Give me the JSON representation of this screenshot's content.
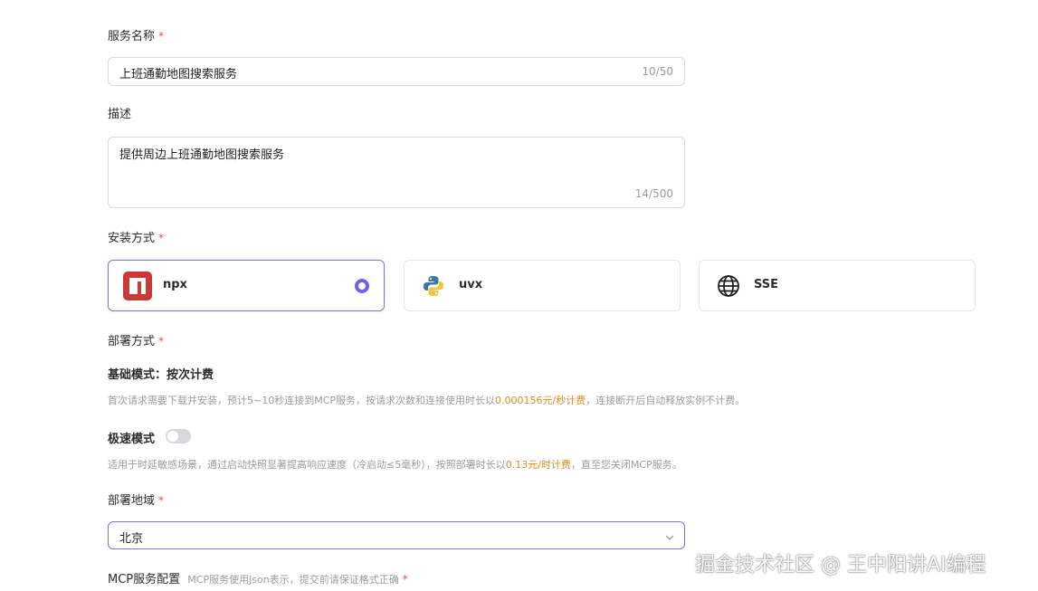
{
  "form": {
    "service_name": {
      "label": "服务名称",
      "required": "*",
      "value": "上班通勤地图搜索服务",
      "counter": "10/50"
    },
    "description": {
      "label": "描述",
      "value": "提供周边上班通勤地图搜索服务",
      "counter": "14/500"
    },
    "install_method": {
      "label": "安装方式",
      "required": "*",
      "options": [
        {
          "name": "npx",
          "icon": "npm-icon",
          "selected": true
        },
        {
          "name": "uvx",
          "icon": "python-icon",
          "selected": false
        },
        {
          "name": "SSE",
          "icon": "globe-icon",
          "selected": false
        }
      ]
    },
    "deploy_method": {
      "label": "部署方式",
      "required": "*",
      "basic": {
        "title": "基础模式：按次计费",
        "desc_pre": "首次请求需要下载并安装，预计5~10秒连接到MCP服务，按请求次数和连接使用时长以",
        "price": "0.000156元/秒计费",
        "desc_post": "，连接断开后自动释放实例不计费。"
      },
      "fast": {
        "title": "极速模式",
        "enabled": false,
        "desc_pre": "适用于时延敏感场景，通过启动快照显著提高响应速度（冷启动≤5毫秒），按照部署时长以",
        "price": "0.13元/时计费",
        "desc_post": "，直至您关闭MCP服务。"
      }
    },
    "region": {
      "label": "部署地域",
      "required": "*",
      "value": "北京"
    },
    "mcp_config": {
      "label": "MCP服务配置",
      "hint": "MCP服务使用Json表示，提交前请保证格式正确",
      "required": "*"
    }
  },
  "watermark": "掘金技术社区 @ 王中阳讲AI编程",
  "colors": {
    "accent": "#6f62e8",
    "price": "#e08a1f",
    "required": "#e5484d"
  }
}
